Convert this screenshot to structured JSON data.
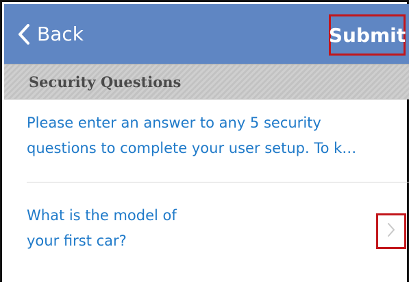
{
  "navbar": {
    "back_label": "Back",
    "back_icon": "chevron-left-icon",
    "submit_label": "Submit",
    "background_color": "#5f86c3"
  },
  "section": {
    "title": "Security Questions"
  },
  "intro": {
    "lines": [
      "Please enter an answer to any 5 security",
      "questions to complete your user setup. To k…"
    ]
  },
  "questions": [
    {
      "lines": [
        "What is the model of",
        "your first car?"
      ],
      "disclosure_icon": "chevron-right-icon"
    }
  ],
  "colors": {
    "link_blue": "#1f7ac9",
    "highlight_red": "#c2161b"
  }
}
